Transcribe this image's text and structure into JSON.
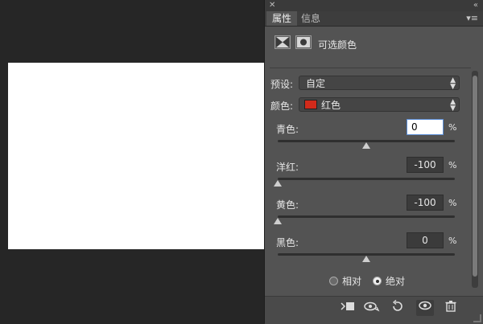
{
  "panel": {
    "tabs": [
      {
        "label": "属性"
      },
      {
        "label": "信息"
      }
    ],
    "adjustment_title": "可选颜色",
    "preset": {
      "label": "预设:",
      "value": "自定"
    },
    "colors": {
      "label": "颜色:",
      "value": "红色",
      "swatch": "#d12a1a"
    },
    "sliders": [
      {
        "label": "青色:",
        "value": "0",
        "percent": 0
      },
      {
        "label": "洋红:",
        "value": "-100",
        "percent": -100
      },
      {
        "label": "黄色:",
        "value": "-100",
        "percent": -100
      },
      {
        "label": "黑色:",
        "value": "0",
        "percent": 0
      }
    ],
    "percent_sign": "%",
    "method": {
      "relative": "相对",
      "absolute": "绝对",
      "selected": "absolute"
    }
  },
  "icons": {
    "close": "close-icon",
    "collapse": "double-chevron-icon",
    "menu": "panel-menu-icon"
  }
}
